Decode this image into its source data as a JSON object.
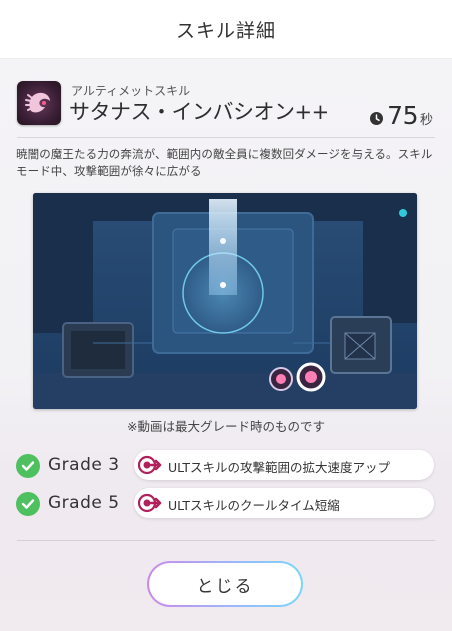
{
  "header": {
    "title": "スキル詳細"
  },
  "skill": {
    "type": "アルティメットスキル",
    "name": "サタナス・インバシオン++",
    "icon": "demon-wing-icon",
    "cooldown_value": "75",
    "cooldown_unit": "秒",
    "description": "暁闇の魔王たる力の奔流が、範囲内の敵全員に複数回ダメージを与える。スキルモード中、攻撃範囲が徐々に広がる"
  },
  "video": {
    "note": "※動画は最大グレード時のものです"
  },
  "grades": [
    {
      "label": "Grade 3",
      "text": "ULTスキルの攻撃範囲の拡大速度アップ",
      "icon": "ult-arrow-icon"
    },
    {
      "label": "Grade 5",
      "text": "ULTスキルのクールタイム短縮",
      "icon": "ult-arrow-icon"
    }
  ],
  "footer": {
    "close_label": "とじる"
  },
  "colors": {
    "check": "#4ec05f",
    "ult_icon": "#b0205a",
    "video_bg": "#1d3858"
  }
}
